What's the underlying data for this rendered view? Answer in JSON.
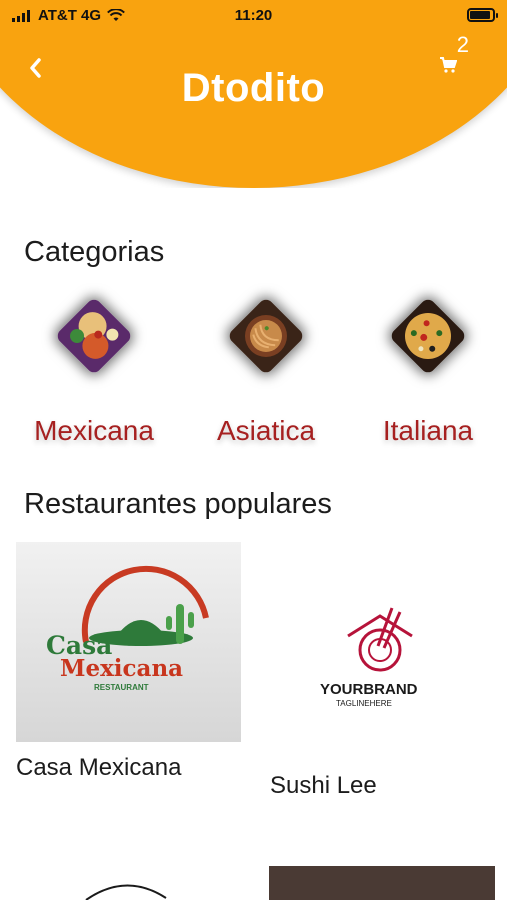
{
  "status_bar": {
    "carrier": "AT&T 4G",
    "time": "11:20"
  },
  "header": {
    "logo": "Dtodito",
    "cart_count": "2",
    "brand_color": "#F9A30F"
  },
  "categories": {
    "title": "Categorias",
    "items": [
      {
        "label": "Mexicana"
      },
      {
        "label": "Asiatica"
      },
      {
        "label": "Italiana"
      }
    ]
  },
  "popular": {
    "title": "Restaurantes populares",
    "items": [
      {
        "name": "Casa Mexicana",
        "logo_line1": "Casa",
        "logo_line2": "Mexicana",
        "logo_sub": "RESTAURANT"
      },
      {
        "name": "Sushi Lee",
        "logo_line1": "YOURBRAND",
        "logo_sub": "TAGLINEHERE"
      }
    ]
  }
}
